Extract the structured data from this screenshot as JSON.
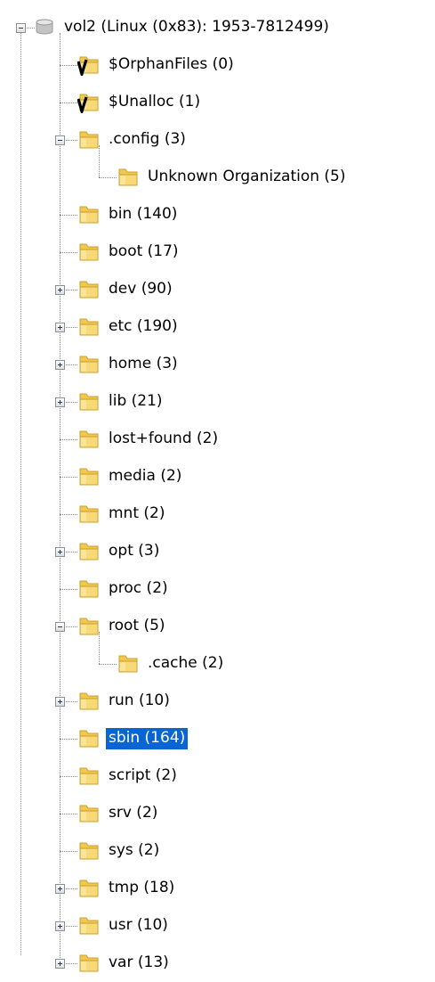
{
  "tree": {
    "root": {
      "label": "vol2 (Linux (0x83): 1953-7812499)",
      "icon": "disk-icon",
      "state": "expanded"
    },
    "items": [
      {
        "label": "$OrphanFiles (0)",
        "icon": "virtual-folder-icon",
        "depth": 1
      },
      {
        "label": "$Unalloc (1)",
        "icon": "virtual-folder-icon",
        "depth": 1
      },
      {
        "label": ".config (3)",
        "icon": "folder-icon",
        "depth": 1,
        "state": "expanded"
      },
      {
        "label": "Unknown Organization (5)",
        "icon": "folder-icon",
        "depth": 2
      },
      {
        "label": "bin (140)",
        "icon": "folder-icon",
        "depth": 1
      },
      {
        "label": "boot (17)",
        "icon": "folder-icon",
        "depth": 1
      },
      {
        "label": "dev (90)",
        "icon": "folder-icon",
        "depth": 1,
        "state": "collapsed"
      },
      {
        "label": "etc (190)",
        "icon": "folder-icon",
        "depth": 1,
        "state": "collapsed"
      },
      {
        "label": "home (3)",
        "icon": "folder-icon",
        "depth": 1,
        "state": "collapsed"
      },
      {
        "label": "lib (21)",
        "icon": "folder-icon",
        "depth": 1,
        "state": "collapsed"
      },
      {
        "label": "lost+found (2)",
        "icon": "folder-icon",
        "depth": 1
      },
      {
        "label": "media (2)",
        "icon": "folder-icon",
        "depth": 1
      },
      {
        "label": "mnt (2)",
        "icon": "folder-icon",
        "depth": 1
      },
      {
        "label": "opt (3)",
        "icon": "folder-icon",
        "depth": 1,
        "state": "collapsed"
      },
      {
        "label": "proc (2)",
        "icon": "folder-icon",
        "depth": 1
      },
      {
        "label": "root (5)",
        "icon": "folder-icon",
        "depth": 1,
        "state": "expanded"
      },
      {
        "label": ".cache (2)",
        "icon": "folder-icon",
        "depth": 2
      },
      {
        "label": "run (10)",
        "icon": "folder-icon",
        "depth": 1,
        "state": "collapsed"
      },
      {
        "label": "sbin (164)",
        "icon": "folder-icon",
        "depth": 1,
        "selected": true
      },
      {
        "label": "script (2)",
        "icon": "folder-icon",
        "depth": 1
      },
      {
        "label": "srv (2)",
        "icon": "folder-icon",
        "depth": 1
      },
      {
        "label": "sys (2)",
        "icon": "folder-icon",
        "depth": 1
      },
      {
        "label": "tmp (18)",
        "icon": "folder-icon",
        "depth": 1,
        "state": "collapsed"
      },
      {
        "label": "usr (10)",
        "icon": "folder-icon",
        "depth": 1,
        "state": "collapsed"
      },
      {
        "label": "var (13)",
        "icon": "folder-icon",
        "depth": 1,
        "state": "collapsed"
      }
    ]
  },
  "colors": {
    "selection": "#0a64d2",
    "folder": "#f2c94c",
    "checkmark": "#000000"
  }
}
